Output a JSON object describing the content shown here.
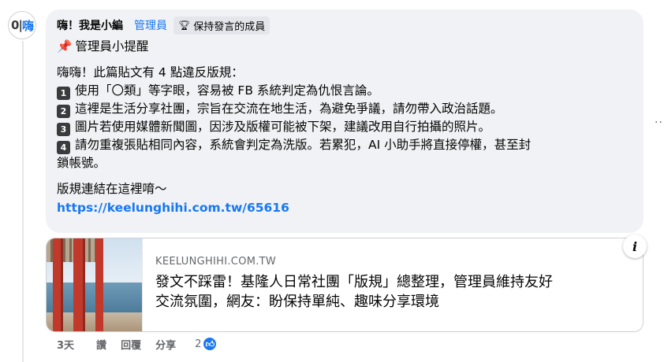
{
  "avatar": {
    "text_left": "0|",
    "text_blue": "嗨"
  },
  "comment": {
    "author": "嗨！我是小編",
    "role": "管理員",
    "badge": "保持發言的成員",
    "badge_icon": "trophy-icon",
    "heading_icon": "pushpin-icon",
    "heading": "管理員小提醒",
    "intro": "嗨嗨！此篇貼文有 4 點違反版規：",
    "rules": [
      {
        "num": "1",
        "text": "使用「〇類」等字眼，容易被 FB 系統判定為仇恨言論。"
      },
      {
        "num": "2",
        "text": "這裡是生活分享社團，宗旨在交流在地生活，為避免爭議，請勿帶入政治話題。"
      },
      {
        "num": "3",
        "text": "圖片若使用媒體新聞圖，因涉及版權可能被下架，建議改用自行拍攝的照片。"
      },
      {
        "num": "4",
        "text_line1": "請勿重複張貼相同內容，系統會判定為洗版。若累犯，AI 小助手將直接停權，甚至封",
        "text_line2": "鎖帳號。"
      }
    ],
    "link_intro": "版規連結在這裡唷～",
    "link": "https://keelunghihi.com.tw/65616"
  },
  "more_button": "··",
  "link_card": {
    "domain": "KEELUNGHIHI.COM.TW",
    "title_line1": "發文不踩雷！基隆人日常社團「版規」總整理，管理員維持友好",
    "title_line2": "交流氛圍，網友：盼保持單純、趣味分享環境",
    "info_icon": "i"
  },
  "actions": {
    "time": "3天",
    "like": "讚",
    "reply": "回覆",
    "share": "分享",
    "reaction_count": "2",
    "reaction_icon": "thumbs-up-icon"
  },
  "colors": {
    "accent": "#1877f2",
    "bubble_bg": "#f0f2f5",
    "secondary_text": "#65676b"
  }
}
